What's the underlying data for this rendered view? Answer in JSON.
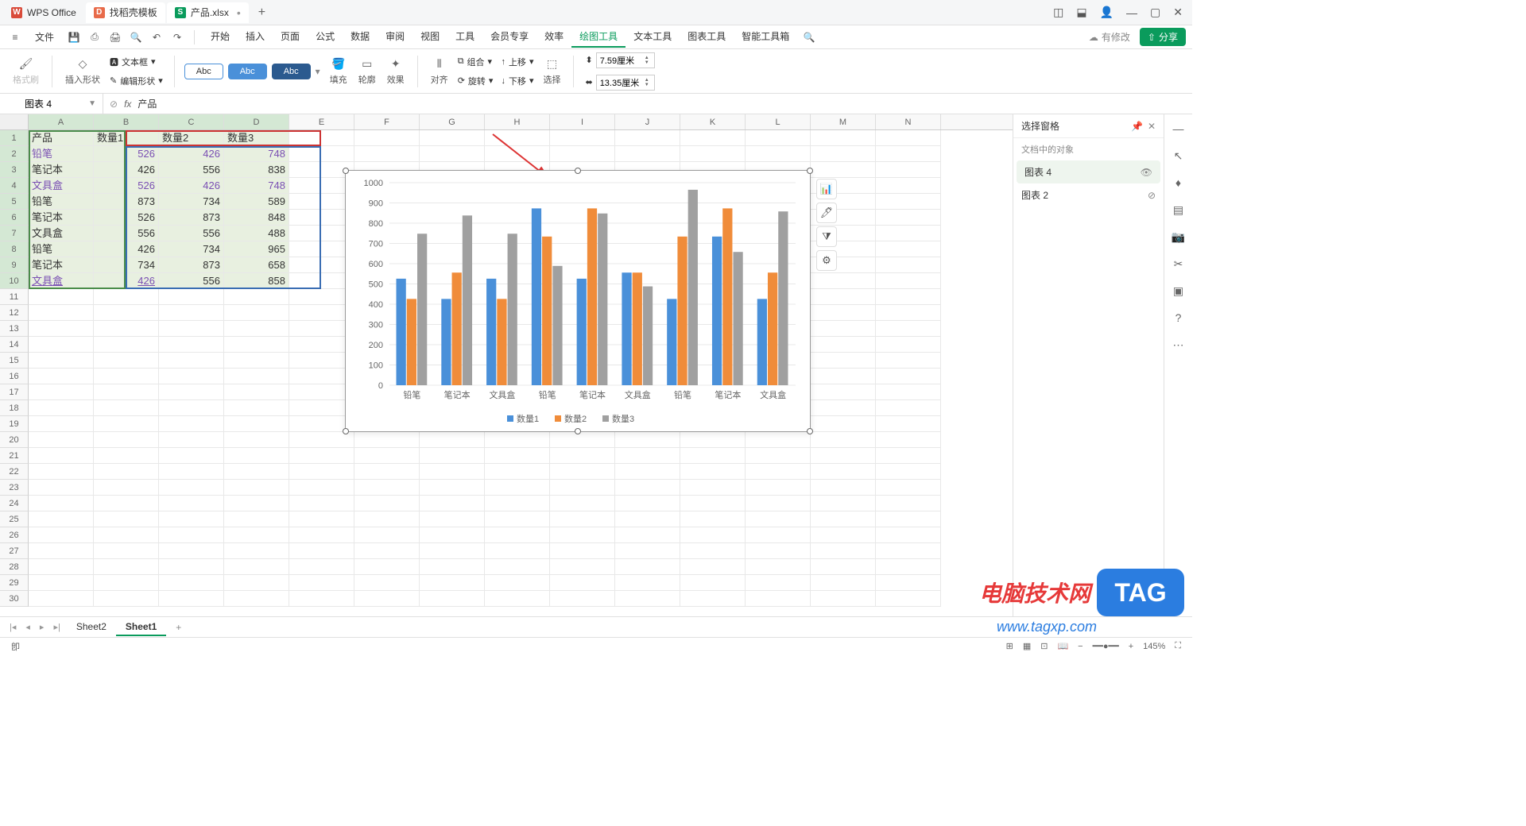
{
  "titlebar": {
    "wps_label": "WPS Office",
    "template_label": "找稻壳模板",
    "file_label": "产品.xlsx",
    "add_tab": "+",
    "win": {
      "layout": "◫",
      "cube": "⬓",
      "user": "👤",
      "min": "—",
      "max": "▢",
      "close": "✕"
    }
  },
  "menubar": {
    "hamburger": "≡",
    "file": "文件",
    "items": [
      "开始",
      "插入",
      "页面",
      "公式",
      "数据",
      "审阅",
      "视图",
      "工具",
      "会员专享",
      "效率",
      "绘图工具",
      "文本工具",
      "图表工具",
      "智能工具箱"
    ],
    "active": "绘图工具",
    "status": "有修改",
    "share": "分享"
  },
  "ribbon": {
    "format_brush": "格式刷",
    "insert_shape": "插入形状",
    "textbox": "文本框",
    "edit_shape": "编辑形状",
    "abc": "Abc",
    "fill": "填充",
    "outline": "轮廓",
    "effect": "效果",
    "align": "对齐",
    "rotate": "旋转",
    "group": "组合",
    "up": "上移",
    "down": "下移",
    "select": "选择",
    "height": "7.59厘米",
    "width": "13.35厘米"
  },
  "namebox": {
    "value": "图表 4"
  },
  "formula": {
    "fx": "fx",
    "value": "产品"
  },
  "columns": [
    "A",
    "B",
    "C",
    "D",
    "E",
    "F",
    "G",
    "H",
    "I",
    "J",
    "K",
    "L",
    "M",
    "N"
  ],
  "table": {
    "headers": [
      "产品",
      "数量1",
      "数量2",
      "数量3"
    ],
    "rows": [
      {
        "p": "铅笔",
        "q": [
          526,
          426,
          748
        ],
        "style": "purple"
      },
      {
        "p": "笔记本",
        "q": [
          426,
          556,
          838
        ],
        "style": ""
      },
      {
        "p": "文具盒",
        "q": [
          526,
          426,
          748
        ],
        "style": "purple"
      },
      {
        "p": "铅笔",
        "q": [
          873,
          734,
          589
        ],
        "style": ""
      },
      {
        "p": "笔记本",
        "q": [
          526,
          873,
          848
        ],
        "style": ""
      },
      {
        "p": "文具盒",
        "q": [
          556,
          556,
          488
        ],
        "style": ""
      },
      {
        "p": "铅笔",
        "q": [
          426,
          734,
          965
        ],
        "style": ""
      },
      {
        "p": "笔记本",
        "q": [
          734,
          873,
          658
        ],
        "style": ""
      },
      {
        "p": "文具盒",
        "q": [
          426,
          556,
          858
        ],
        "style": "underline"
      }
    ],
    "blank_rows": 20
  },
  "chart_data": {
    "type": "bar",
    "categories": [
      "铅笔",
      "笔记本",
      "文具盒",
      "铅笔",
      "笔记本",
      "文具盒",
      "铅笔",
      "笔记本",
      "文具盒"
    ],
    "series": [
      {
        "name": "数量1",
        "color": "#4a90d9",
        "values": [
          526,
          426,
          526,
          873,
          526,
          556,
          426,
          734,
          426
        ]
      },
      {
        "name": "数量2",
        "color": "#f08c3a",
        "values": [
          426,
          556,
          426,
          734,
          873,
          556,
          734,
          873,
          556
        ]
      },
      {
        "name": "数量3",
        "color": "#a0a0a0",
        "values": [
          748,
          838,
          748,
          589,
          848,
          488,
          965,
          658,
          858
        ]
      }
    ],
    "ylim": [
      0,
      1000
    ],
    "yticks": [
      0,
      100,
      200,
      300,
      400,
      500,
      600,
      700,
      800,
      900,
      1000
    ],
    "legend": [
      "数量1",
      "数量2",
      "数量3"
    ]
  },
  "right_panel": {
    "title": "选择窗格",
    "subtitle": "文档中的对象",
    "items": [
      {
        "label": "图表 4",
        "visible": true,
        "active": true
      },
      {
        "label": "图表 2",
        "visible": false,
        "active": false
      }
    ]
  },
  "sheets": {
    "tabs": [
      "Sheet2",
      "Sheet1"
    ],
    "active": "Sheet1",
    "add": "+"
  },
  "statusbar": {
    "zoom": "145%",
    "ready": "卽"
  },
  "watermark": {
    "text": "电脑技术网",
    "tag": "TAG",
    "url": "www.tagxp.com"
  }
}
